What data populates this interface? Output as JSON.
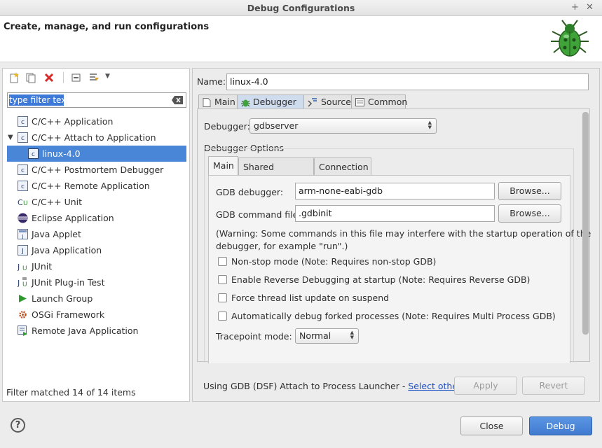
{
  "window": {
    "title": "Debug Configurations",
    "header_title": "Create, manage, and run configurations"
  },
  "left": {
    "filter_placeholder": "type filter text",
    "tree": [
      {
        "label": "C/C++ Application",
        "icon": "c-app-icon"
      },
      {
        "label": "C/C++ Attach to Application",
        "icon": "c-attach-icon",
        "expanded": true
      },
      {
        "label": "linux-4.0",
        "icon": "c-config-icon",
        "selected": true
      },
      {
        "label": "C/C++ Postmortem Debugger",
        "icon": "c-postmortem-icon"
      },
      {
        "label": "C/C++ Remote Application",
        "icon": "c-remote-icon"
      },
      {
        "label": "C/C++ Unit",
        "icon": "c-unit-icon"
      },
      {
        "label": "Eclipse Application",
        "icon": "eclipse-icon"
      },
      {
        "label": "Java Applet",
        "icon": "java-applet-icon"
      },
      {
        "label": "Java Application",
        "icon": "java-app-icon"
      },
      {
        "label": "JUnit",
        "icon": "junit-icon"
      },
      {
        "label": "JUnit Plug-in Test",
        "icon": "junit-plugin-icon"
      },
      {
        "label": "Launch Group",
        "icon": "launch-group-icon"
      },
      {
        "label": "OSGi Framework",
        "icon": "osgi-icon"
      },
      {
        "label": "Remote Java Application",
        "icon": "remote-java-icon"
      }
    ],
    "status": "Filter matched 14 of 14 items"
  },
  "right": {
    "name_label": "Name:",
    "name_value": "linux-4.0",
    "tabs": [
      {
        "label": "Main",
        "icon": "file-icon"
      },
      {
        "label": "Debugger",
        "icon": "bug-icon",
        "active": true
      },
      {
        "label": "Source",
        "icon": "source-icon"
      },
      {
        "label": "Common",
        "icon": "common-icon"
      }
    ],
    "debugger_label": "Debugger:",
    "debugger_value": "gdbserver",
    "options_label": "Debugger Options",
    "inner_tabs": [
      {
        "label": "Main",
        "active": true
      },
      {
        "label": "Shared Libraries"
      },
      {
        "label": "Connection"
      }
    ],
    "gdb_debugger_label": "GDB debugger:",
    "gdb_debugger_value": "arm-none-eabi-gdb",
    "gdb_cmd_label": "GDB command file:",
    "gdb_cmd_value": ".gdbinit",
    "browse_label": "Browse...",
    "warning_line1": "(Warning: Some commands in this file may interfere with the startup operation of the",
    "warning_line2": "debugger, for example \"run\".)",
    "checkboxes": [
      {
        "label": "Non-stop mode (Note: Requires non-stop GDB)",
        "checked": false
      },
      {
        "label": "Enable Reverse Debugging at startup (Note: Requires Reverse GDB)",
        "checked": false
      },
      {
        "label": "Force thread list update on suspend",
        "checked": false
      },
      {
        "label": "Automatically debug forked processes (Note: Requires Multi Process GDB)",
        "checked": false
      }
    ],
    "tracepoint_label": "Tracepoint mode:",
    "tracepoint_value": "Normal",
    "launcher_text": "Using GDB (DSF) Attach to Process Launcher - ",
    "launcher_link": "Select other...",
    "apply_label": "Apply",
    "revert_label": "Revert"
  },
  "footer": {
    "help_label": "?",
    "close_label": "Close",
    "debug_label": "Debug"
  },
  "colors": {
    "selection": "#4a86d8",
    "active_tab": "#cfdcee",
    "primary_button": "#4a86d8"
  }
}
